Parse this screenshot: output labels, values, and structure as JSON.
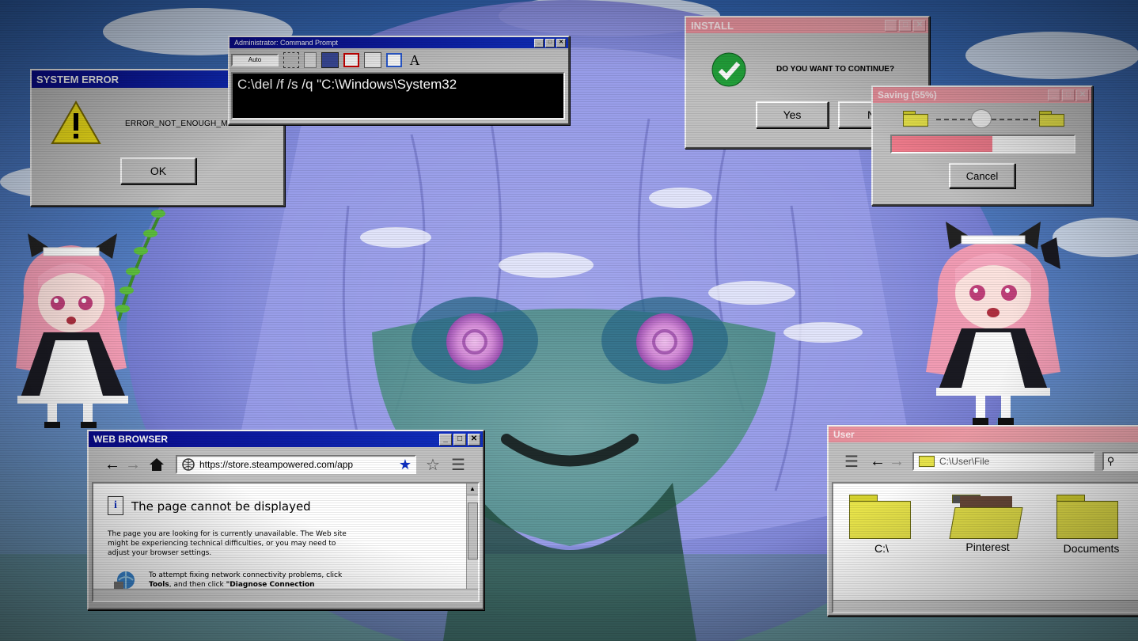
{
  "colors": {
    "titlebar_blue": "#0a0a8a",
    "titlebar_pink": "#f0a8b0",
    "window_gray": "#c0c0c0",
    "progress_pink": "#f07c8c"
  },
  "system_error": {
    "title": "SYSTEM ERROR",
    "icon": "warning-icon",
    "message": "ERROR_NOT_ENOUGH_MEMORY",
    "ok_label": "OK"
  },
  "cmd": {
    "title": "Administrator: Command Prompt",
    "font_select": "Auto",
    "toolbar_icons": [
      "mark-icon",
      "copy-icon",
      "paste-icon",
      "fullscreen-icon",
      "properties-icon",
      "background-icon",
      "font-icon"
    ],
    "font_glyph": "A",
    "command": "C:\\del /f /s /q \"C:\\Windows\\System32"
  },
  "install": {
    "title": "INSTALL",
    "icon": "check-icon",
    "question": "DO YOU WANT TO CONTINUE?",
    "yes_label": "Yes",
    "no_label": "No"
  },
  "saving": {
    "title": "Saving (55%)",
    "progress": 0.55,
    "cancel_label": "Cancel"
  },
  "browser": {
    "title": "WEB BROWSER",
    "url": "https://store.steampowered.com/app",
    "error_title": "The page cannot be displayed",
    "error_body": "The page you are looking for is currently unavailable. The Web site might be experiencing technical difficulties, or you may need to adjust your browser settings.",
    "hint_line1": "To attempt fixing network connectivity problems, click",
    "hint_tools": "Tools",
    "hint_mid": ", and then click ",
    "hint_diag": "\"Diagnose Connection"
  },
  "explorer": {
    "title": "User",
    "path": "C:\\User\\File",
    "folders": [
      {
        "label": "C:\\"
      },
      {
        "label": "Pinterest"
      },
      {
        "label": "Documents"
      }
    ]
  }
}
